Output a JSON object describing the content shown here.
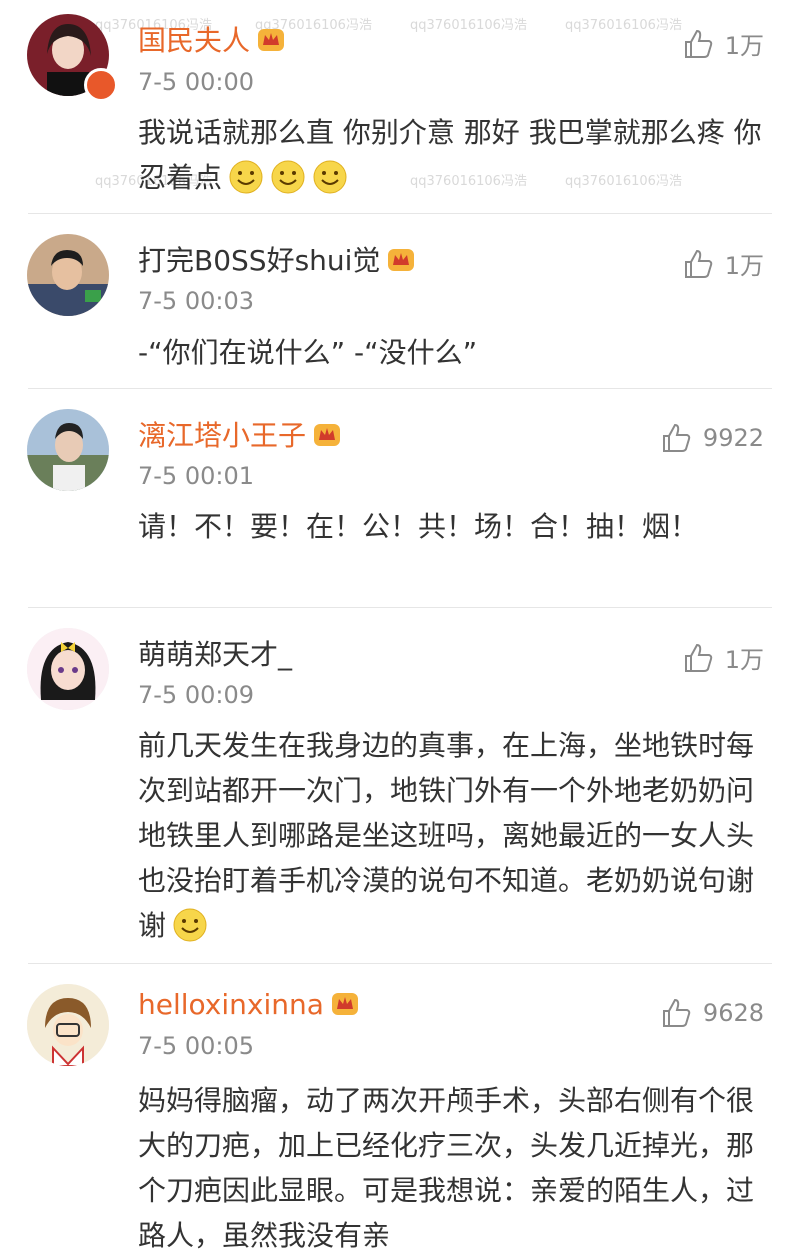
{
  "watermark": "qq376016106冯浩",
  "comments": [
    {
      "username": "国民夫人",
      "time": "7-5 00:00",
      "likes": "1万",
      "text": "我说话就那么直 你别介意 那好 我巴掌就那么疼 你忍着点",
      "emoji_count": 3,
      "vip": true
    },
    {
      "username": "打完B0SS好shui觉",
      "time": "7-5 00:03",
      "likes": "1万",
      "text": "-“你们在说什么” -“没什么”",
      "emoji_count": 0,
      "vip": false
    },
    {
      "username": "漓江塔小王子",
      "time": "7-5 00:01",
      "likes": "9922",
      "text": "请！不！要！在！公！共！场！合！抽！烟！",
      "emoji_count": 0,
      "vip": true
    },
    {
      "username": "萌萌郑天才_",
      "time": "7-5 00:09",
      "likes": "1万",
      "text": "前几天发生在我身边的真事，在上海，坐地铁时每次到站都开一次门，地铁门外有一个外地老奶奶问地铁里人到哪路是坐这班吗，离她最近的一女人头也没抬盯着手机冷漠的说句不知道。老奶奶说句谢谢",
      "emoji_count": 1,
      "vip": false
    },
    {
      "username": "helloxinxinna",
      "time": "7-5 00:05",
      "likes": "9628",
      "text": "妈妈得脑瘤，动了两次开颅手术，头部右侧有个很大的刀疤，加上已经化疗三次，头发几近掉光，那个刀疤因此显眼。可是我想说：亲爱的陌生人，过路人，虽然我没有亲",
      "emoji_count": 0,
      "vip": true
    }
  ],
  "colors": {
    "vip_name": "#e8682a",
    "text": "#333333",
    "meta": "#8a8a8a",
    "divider": "#e6e6e6"
  },
  "icons": {
    "like": "thumbs-up-icon",
    "badge": "crown-vip-icon",
    "emoji": "smile-emoji-icon"
  }
}
